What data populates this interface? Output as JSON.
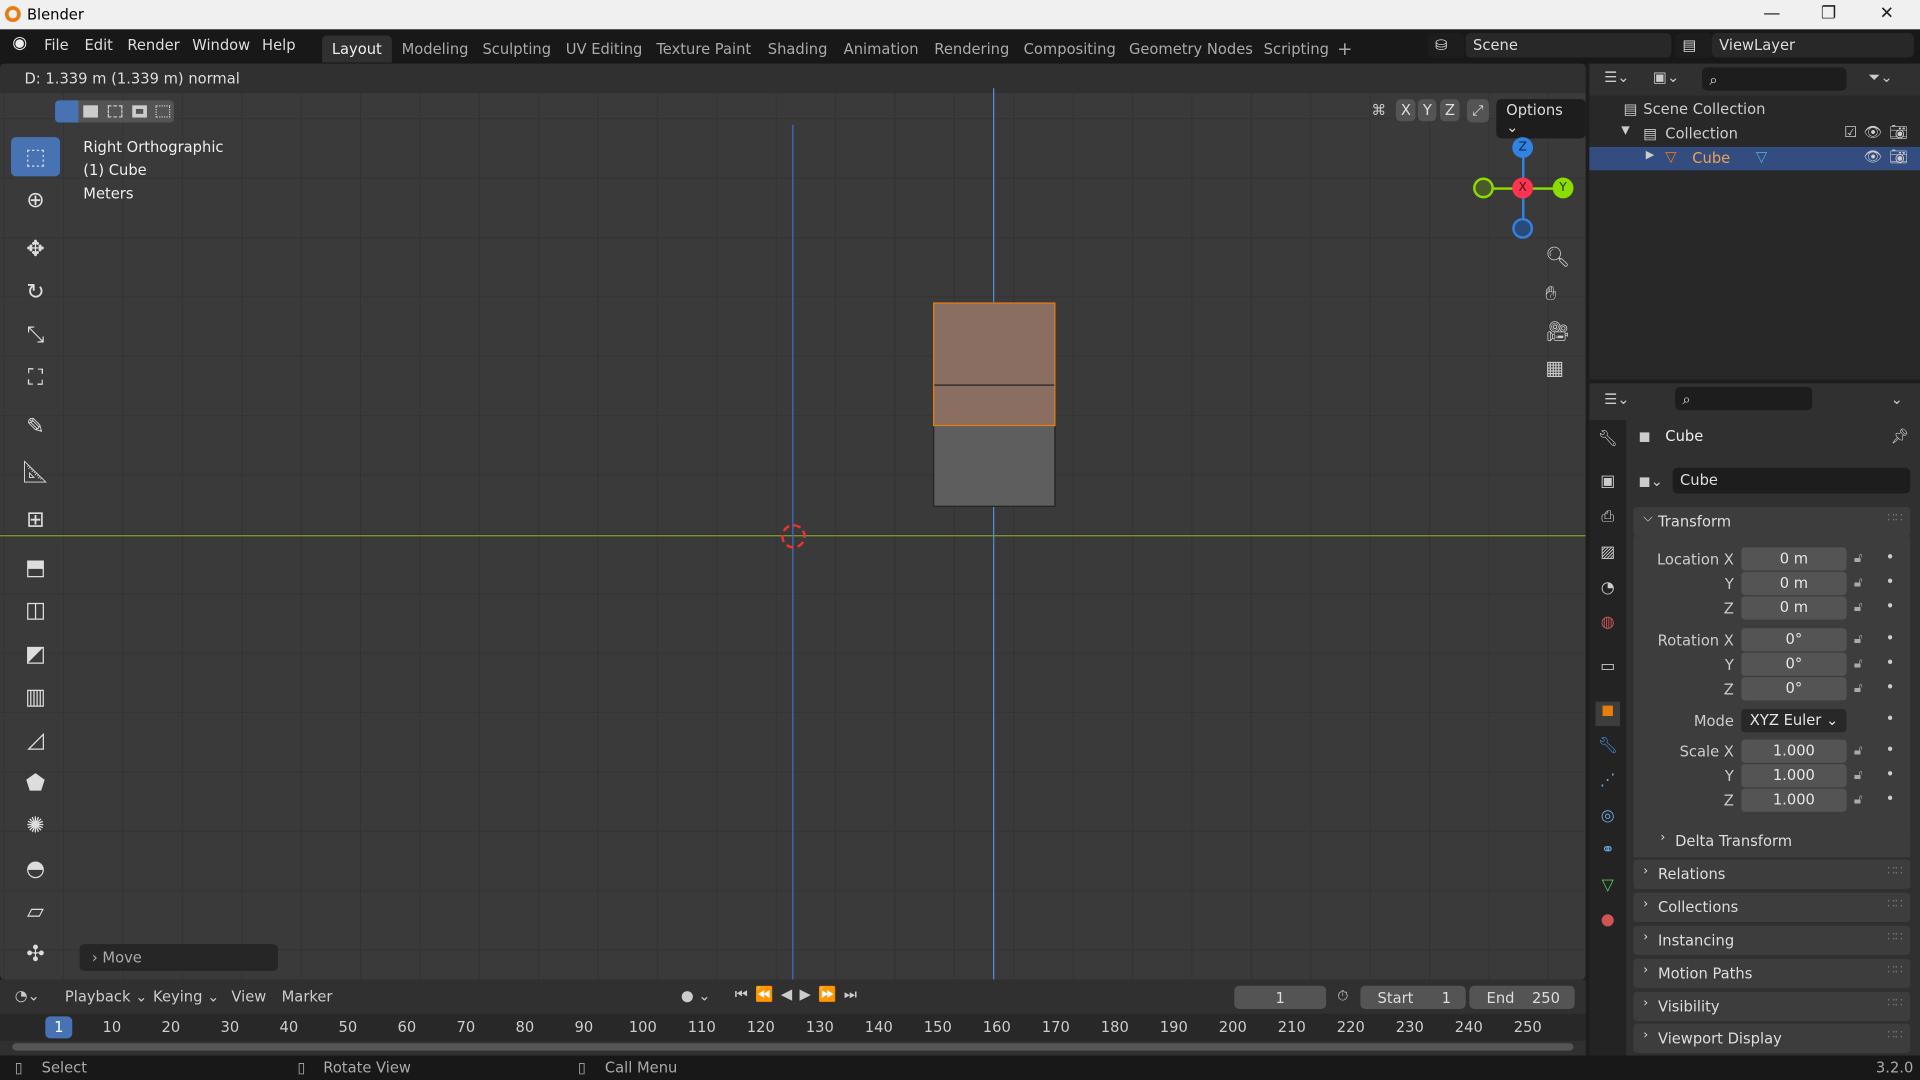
{
  "window": {
    "title": "Blender",
    "minimize": "—",
    "maximize": "❐",
    "close": "✕"
  },
  "menu": [
    "File",
    "Edit",
    "Render",
    "Window",
    "Help"
  ],
  "workspaces": [
    "Layout",
    "Modeling",
    "Sculpting",
    "UV Editing",
    "Texture Paint",
    "Shading",
    "Animation",
    "Rendering",
    "Compositing",
    "Geometry Nodes",
    "Scripting"
  ],
  "workspace_add": "+",
  "scene": "Scene",
  "view_layer": "ViewLayer",
  "viewport": {
    "header_status": "D: 1.339 m (1.339 m) normal",
    "view_name": "Right Orthographic",
    "object": "(1) Cube",
    "units": "Meters",
    "axes": [
      "X",
      "Y",
      "Z"
    ],
    "options": "Options",
    "last_op": "Move",
    "colors": {
      "selected": "#e87d0d",
      "x_axis": "#ff3352",
      "y_axis": "#8bdc00",
      "z_axis": "#2f83e3",
      "z_line": "#3f6fc7",
      "y_line": "#7fa02a"
    }
  },
  "gizmo": {
    "z": "Z",
    "x": "X",
    "y": "Y"
  },
  "outliner": {
    "items": [
      {
        "label": "Scene Collection"
      },
      {
        "label": "Collection"
      },
      {
        "label": "Cube",
        "selected": true
      }
    ]
  },
  "properties": {
    "object_name": "Cube",
    "data_name": "Cube",
    "transform": "Transform",
    "location": {
      "label": "Location X",
      "x": "0 m",
      "y": "0 m",
      "z": "0 m"
    },
    "rotation": {
      "label": "Rotation X",
      "x": "0°",
      "y": "0°",
      "z": "0°"
    },
    "mode": {
      "label": "Mode",
      "value": "XYZ Euler"
    },
    "scale": {
      "label": "Scale X",
      "x": "1.000",
      "y": "1.000",
      "z": "1.000"
    },
    "axis_y": "Y",
    "axis_z": "Z",
    "delta": "Delta Transform",
    "panels": [
      "Relations",
      "Collections",
      "Instancing",
      "Motion Paths",
      "Visibility",
      "Viewport Display"
    ]
  },
  "timeline": {
    "menus": [
      "Playback",
      "Keying",
      "View",
      "Marker"
    ],
    "current_frame": "1",
    "start_label": "Start",
    "start": "1",
    "end_label": "End",
    "end": "250",
    "ticks": [
      "1",
      "10",
      "20",
      "30",
      "40",
      "50",
      "60",
      "70",
      "80",
      "90",
      "100",
      "110",
      "120",
      "130",
      "140",
      "150",
      "160",
      "170",
      "180",
      "190",
      "200",
      "210",
      "220",
      "230",
      "240",
      "250"
    ]
  },
  "status": {
    "select": "Select",
    "rotate": "Rotate View",
    "menu": "Call Menu",
    "version": "3.2.0"
  }
}
